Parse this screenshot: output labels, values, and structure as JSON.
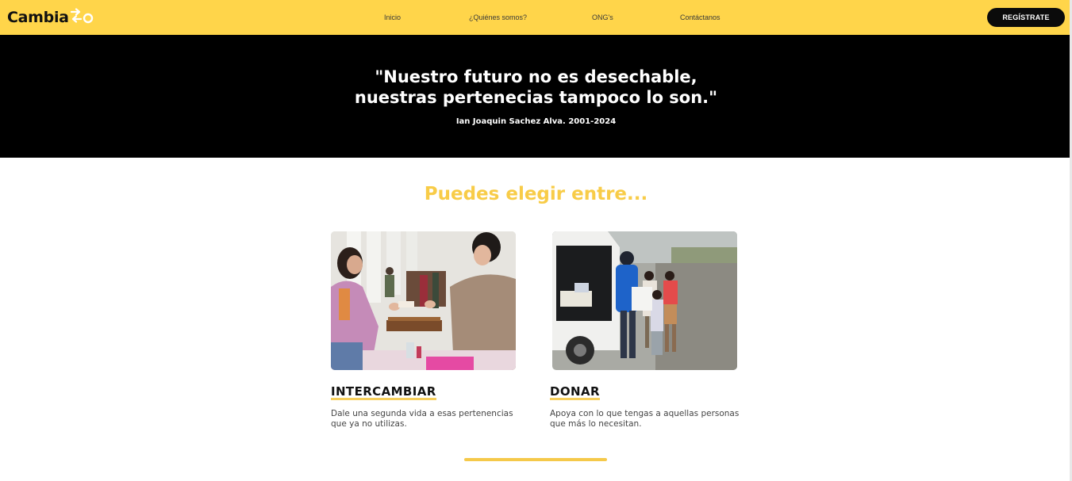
{
  "header": {
    "logo_text": "Cambia",
    "logo_mark_icon": "swap-arrows-icon",
    "nav": [
      "Inicio",
      "¿Quiénes somos?",
      "ONG's",
      "Contáctanos"
    ],
    "register_label": "REGÍSTRATE",
    "accent_color": "#ffd54a"
  },
  "hero": {
    "quote_line1": "\"Nuestro futuro no es desechable,",
    "quote_line2": "nuestras pertenecias tampoco lo son.\"",
    "author": "Ian Joaquin Sachez Alva. 2001-2024"
  },
  "section": {
    "title": "Puedes elegir entre...",
    "title_color": "#f8cc48"
  },
  "cards": [
    {
      "title": "INTERCAMBIAR",
      "description_line1": "Dale una segunda vida a esas pertenencias",
      "description_line2": "que ya no utilizas.",
      "image": "exchange-photo"
    },
    {
      "title": "DONAR",
      "description_line1": "Apoya con lo que tengas a aquellas personas",
      "description_line2": "que más lo necesitan.",
      "image": "donation-photo"
    }
  ]
}
